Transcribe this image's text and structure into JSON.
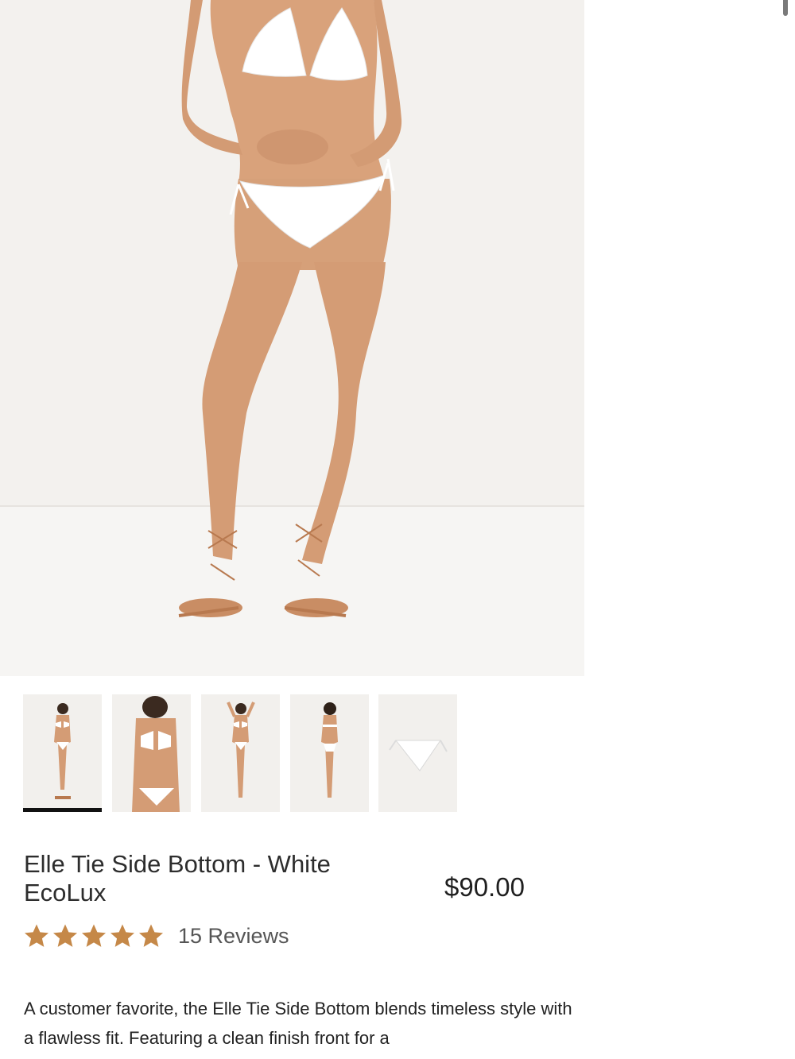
{
  "product": {
    "title": "Elle Tie Side Bottom - White EcoLux",
    "price": "$90.00",
    "rating": 5,
    "reviews_label": "15 Reviews",
    "description": "A customer favorite, the Elle Tie Side Bottom blends timeless style with a flawless fit. Featuring a clean finish front for a"
  },
  "gallery": {
    "active_index": 0,
    "thumbnails": [
      {
        "icon": "model-front-full-icon"
      },
      {
        "icon": "model-closeup-icon"
      },
      {
        "icon": "model-arms-up-icon"
      },
      {
        "icon": "model-back-icon"
      },
      {
        "icon": "product-flatlay-icon"
      }
    ]
  },
  "colors": {
    "star": "#c58848",
    "accent": "#111111",
    "image_bg": "#f4f2ef"
  }
}
